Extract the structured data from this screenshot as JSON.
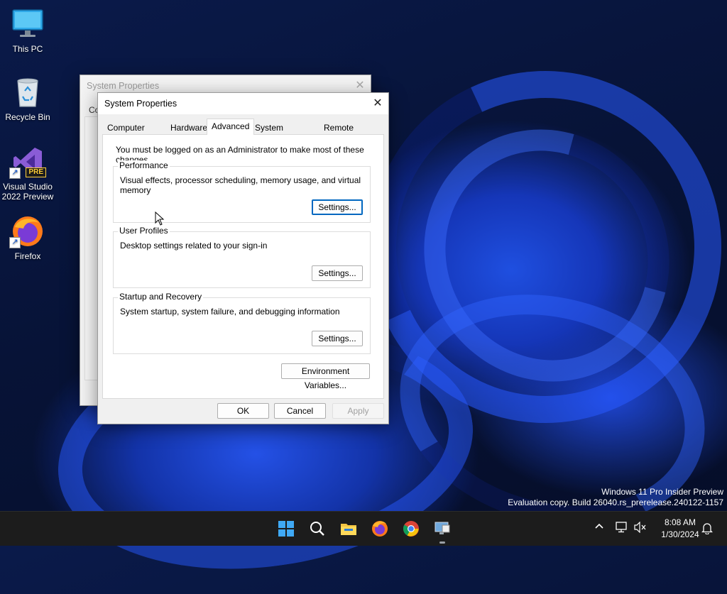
{
  "desktop": {
    "icons": [
      {
        "label": "This PC"
      },
      {
        "label": "Recycle Bin"
      },
      {
        "label": "Visual Studio 2022 Preview",
        "badge": "PRE"
      },
      {
        "label": "Firefox"
      }
    ]
  },
  "background_window": {
    "title": "System Properties",
    "tab_fragment": "Co"
  },
  "dialog": {
    "title": "System Properties",
    "tabs": [
      {
        "label": "Computer Name"
      },
      {
        "label": "Hardware"
      },
      {
        "label": "Advanced",
        "active": true
      },
      {
        "label": "System Protection"
      },
      {
        "label": "Remote"
      }
    ],
    "admin_note": "You must be logged on as an Administrator to make most of these changes.",
    "groups": [
      {
        "title": "Performance",
        "description": "Visual effects, processor scheduling, memory usage, and virtual memory",
        "button": "Settings..."
      },
      {
        "title": "User Profiles",
        "description": "Desktop settings related to your sign-in",
        "button": "Settings..."
      },
      {
        "title": "Startup and Recovery",
        "description": "System startup, system failure, and debugging information",
        "button": "Settings..."
      }
    ],
    "env_button": "Environment Variables...",
    "ok": "OK",
    "cancel": "Cancel",
    "apply": "Apply"
  },
  "watermark": {
    "line1": "Windows 11 Pro Insider Preview",
    "line2": "Evaluation copy. Build 26040.rs_prerelease.240122-1157"
  },
  "taskbar": {
    "apps": [
      "start-icon",
      "search-icon",
      "file-explorer-icon",
      "firefox-icon",
      "chrome-icon",
      "system-properties-icon"
    ],
    "time": "8:08 AM",
    "date": "1/30/2024"
  },
  "colors": {
    "accent": "#0067c0",
    "taskbar": "#1c1c1c"
  }
}
